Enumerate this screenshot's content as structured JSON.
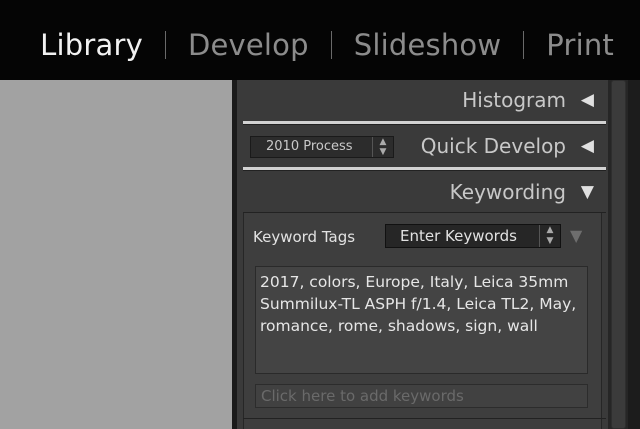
{
  "modules": {
    "library": "Library",
    "develop": "Develop",
    "slideshow": "Slideshow",
    "print": "Print"
  },
  "panels": {
    "histogram": {
      "title": "Histogram",
      "arrow": "◀"
    },
    "quick_develop": {
      "title": "Quick Develop",
      "arrow": "◀",
      "process_value": "2010 Process"
    },
    "keywording": {
      "title": "Keywording",
      "arrow": "▼",
      "tags_label": "Keyword Tags",
      "tags_mode": "Enter Keywords",
      "keywords": "2017, colors, Europe, Italy, Leica 35mm Summilux-TL ASPH f/1.4, Leica TL2, May, romance, rome, shadows, sign, wall",
      "add_placeholder": "Click here to add keywords"
    }
  }
}
